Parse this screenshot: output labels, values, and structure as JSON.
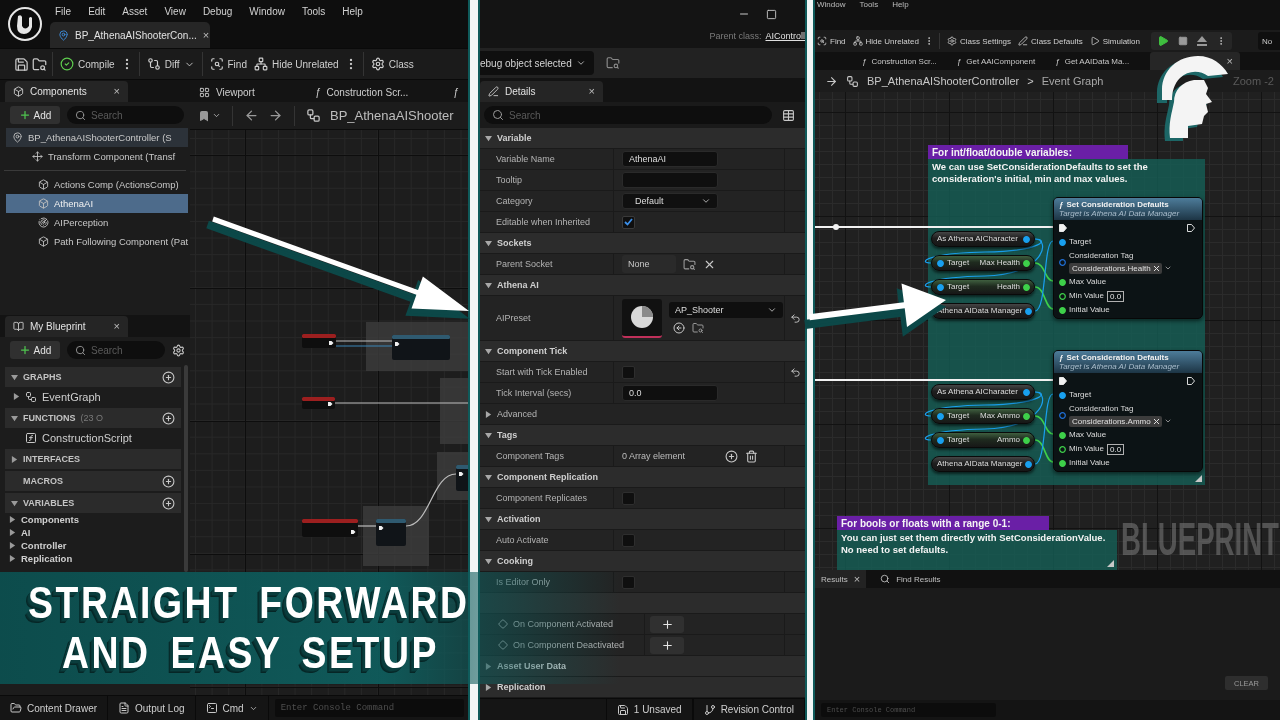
{
  "left_editor": {
    "menu": [
      "File",
      "Edit",
      "Asset",
      "View",
      "Debug",
      "Window",
      "Tools",
      "Help"
    ],
    "document_tab": {
      "title": "BP_AthenaAIShooterCon...",
      "close": "×"
    },
    "toolbar": [
      {
        "label": "Compile",
        "kind": "menu"
      },
      {
        "label": "Diff",
        "kind": "dropdown"
      },
      {
        "label": "Find",
        "kind": "plain"
      },
      {
        "label": "Hide Unrelated",
        "kind": "menu"
      },
      {
        "label": "Class",
        "kind": "plain"
      }
    ],
    "components_panel": {
      "tab": "Components",
      "close": "×",
      "add": "Add",
      "search_placeholder": "Search",
      "tree": [
        {
          "label": "BP_AthenaAIShooterController (S",
          "kind": "actor",
          "selected": false,
          "children": [
            {
              "label": "Transform Component (Transf",
              "kind": "transform",
              "selected": false
            },
            {
              "label": "Actions Comp (ActionsComp)",
              "kind": "component",
              "selected": false
            },
            {
              "label": "AthenaAI",
              "kind": "component",
              "selected": true
            },
            {
              "label": "AIPerception",
              "kind": "perception",
              "selected": false
            },
            {
              "label": "Path Following Component (Pat",
              "kind": "component",
              "selected": false
            }
          ]
        }
      ]
    },
    "graph_tabs": [
      {
        "kind": "viewport",
        "label": "Viewport"
      },
      {
        "kind": "function",
        "icon": "ƒ",
        "label": "Construction Scr..."
      },
      {
        "kind": "function",
        "icon": "ƒ"
      }
    ],
    "graph_breadcrumb": "BP_AthenaAIShooter",
    "blueprint_panel": {
      "tab": "My Blueprint",
      "close": "×",
      "add": "Add",
      "search_placeholder": "Search",
      "sections": [
        {
          "title": "GRAPHS",
          "expanded": true,
          "addable": true,
          "items": [
            {
              "label": "EventGraph",
              "kind": "graph",
              "expanded": false
            }
          ]
        },
        {
          "title": "FUNCTIONS",
          "count": "(23 O",
          "expanded": true,
          "addable": true,
          "items": [
            {
              "label": "ConstructionScript",
              "kind": "function"
            }
          ]
        },
        {
          "title": "INTERFACES",
          "expanded": false,
          "addable": false
        },
        {
          "title": "MACROS",
          "addable": true
        },
        {
          "title": "VARIABLES",
          "expanded": true,
          "addable": true,
          "items": [
            {
              "label": "Components",
              "kind": "category",
              "expanded": false
            },
            {
              "label": "AI",
              "kind": "category",
              "expanded": false
            },
            {
              "label": "Controller",
              "kind": "category",
              "expanded": false
            },
            {
              "label": "Replication",
              "kind": "category",
              "expanded": false
            }
          ]
        }
      ]
    },
    "status_bar": {
      "buttons": [
        {
          "label": "Content Drawer"
        },
        {
          "label": "Output Log"
        }
      ],
      "command": "Cmd",
      "console_placeholder": "Enter Console Command"
    }
  },
  "details_editor": {
    "parent_class": {
      "label": "Parent class:",
      "value": "AIControll"
    },
    "debug_filter": "ebug object selected",
    "tab": {
      "title": "Details",
      "close": "×"
    },
    "search_placeholder": "Search",
    "rows": [
      {
        "kind": "section",
        "title": "Variable",
        "expanded": true
      },
      {
        "kind": "text",
        "label": "Variable Name",
        "value": "AthenaAI",
        "modified": false
      },
      {
        "kind": "text",
        "label": "Tooltip",
        "modified": false
      },
      {
        "kind": "dropdown",
        "label": "Category",
        "value": "Default",
        "modified": false
      },
      {
        "kind": "checkbox",
        "label": "Editable when Inherited",
        "checked": true,
        "modified": false
      },
      {
        "kind": "section",
        "title": "Sockets",
        "expanded": true
      },
      {
        "kind": "socket",
        "label": "Parent Socket",
        "value": "None",
        "modified": false
      },
      {
        "kind": "section",
        "title": "Athena AI",
        "expanded": true
      },
      {
        "kind": "asset",
        "label": "AIPreset",
        "value": "AP_Shooter",
        "modified": true
      },
      {
        "kind": "section",
        "title": "Component Tick",
        "expanded": true
      },
      {
        "kind": "checkbox",
        "label": "Start with Tick Enabled",
        "checked": false,
        "modified": true
      },
      {
        "kind": "text",
        "label": "Tick Interval (secs)",
        "value": "0.0",
        "modified": false
      },
      {
        "kind": "subsection",
        "title": "Advanced",
        "expanded": false
      },
      {
        "kind": "section",
        "title": "Tags",
        "expanded": true
      },
      {
        "kind": "array",
        "label": "Component Tags",
        "value": "0 Array element",
        "modified": false
      },
      {
        "kind": "section",
        "title": "Component Replication",
        "expanded": true
      },
      {
        "kind": "checkbox",
        "label": "Component Replicates",
        "checked": false,
        "modified": false
      },
      {
        "kind": "section",
        "title": "Activation",
        "expanded": true
      },
      {
        "kind": "checkbox",
        "label": "Auto Activate",
        "checked": false,
        "modified": false
      },
      {
        "kind": "section",
        "title": "Cooking",
        "expanded": true
      },
      {
        "kind": "checkbox",
        "label": "Is Editor Only",
        "checked": false,
        "modified": false
      },
      {
        "kind": "section"
      },
      {
        "kind": "event",
        "label": "On Component Activated",
        "modified": false
      },
      {
        "kind": "event",
        "label": "On Component Deactivated",
        "modified": false
      },
      {
        "kind": "section",
        "title": "Asset User Data",
        "expanded": false
      },
      {
        "kind": "section",
        "title": "Replication",
        "expanded": false
      }
    ],
    "status_bar": [
      {
        "label": "1 Unsaved"
      },
      {
        "label": "Revision Control"
      }
    ]
  },
  "graph_editor": {
    "menu": [
      "Window",
      "Tools",
      "Help"
    ],
    "toolbar": [
      {
        "label": "Find",
        "kind": "plain"
      },
      {
        "label": "Hide Unrelated",
        "kind": "menu"
      },
      {
        "label": "Class Settings",
        "kind": "plain"
      },
      {
        "label": "Class Defaults",
        "kind": "plain"
      },
      {
        "label": "Simulation",
        "kind": "plain"
      }
    ],
    "debug_filter": "No",
    "tabs": [
      {
        "kind": "function",
        "icon": "ƒ",
        "label": "Construction Scr...",
        "selected": false
      },
      {
        "kind": "function",
        "icon": "ƒ",
        "label": "Get AAIComponent",
        "selected": false
      },
      {
        "kind": "function",
        "icon": "ƒ",
        "label": "Get AAIData Ma...",
        "selected": false
      },
      {
        "kind": "graph",
        "close": "×",
        "selected": true
      }
    ],
    "breadcrumb": {
      "blueprint": "BP_AthenaAIShooterController",
      "separator": ">",
      "graph": "Event Graph"
    },
    "zoom": "Zoom -2",
    "graph_type": "BLUEPRINT",
    "comments": [
      {
        "title": "For int/float/double variables:",
        "lines": [
          "We can use SetConsiderationDefaults to set the",
          "consideration's initial, min and max values."
        ]
      },
      {
        "title": "For bools or floats with a range 0-1:",
        "lines": [
          "You can just set them directly with SetConsiderationValue.",
          "No need to set defaults."
        ]
      }
    ],
    "node_groups": [
      {
        "function": {
          "icon": "ƒ",
          "title": "Set Consideration Defaults",
          "subtitle": "Target is Athena AI Data Manager",
          "exec": {
            "input_connected": true,
            "output_connected": false
          },
          "pins": [
            {
              "label": "Target",
              "kind": "object",
              "connected": true
            },
            {
              "label": "Consideration Tag",
              "kind": "tag",
              "connected": false,
              "value": "Considerations.Health"
            },
            {
              "label": "Max Value",
              "kind": "float",
              "connected": true
            },
            {
              "label": "Min Value",
              "kind": "float",
              "connected": false,
              "value": "0.0"
            },
            {
              "label": "Initial Value",
              "kind": "float",
              "connected": true
            }
          ]
        },
        "cast": {
          "label": "As Athena AICharacter",
          "connected": true
        },
        "getters": [
          {
            "input": "Target",
            "output": "Max Health",
            "input_connected": true,
            "output_connected": true
          },
          {
            "input": "Target",
            "output": "Health",
            "input_connected": true,
            "output_connected": true
          }
        ],
        "manager": {
          "label": "Athena AIData Manager",
          "connected": true
        }
      },
      {
        "function": {
          "icon": "ƒ",
          "title": "Set Consideration Defaults",
          "subtitle": "Target is Athena AI Data Manager",
          "exec": {
            "input_connected": true,
            "output_connected": false
          },
          "pins": [
            {
              "label": "Target",
              "kind": "object",
              "connected": true
            },
            {
              "label": "Consideration Tag",
              "kind": "tag",
              "connected": false,
              "value": "Considerations.Ammo"
            },
            {
              "label": "Max Value",
              "kind": "float",
              "connected": true
            },
            {
              "label": "Min Value",
              "kind": "float",
              "connected": false,
              "value": "0.0"
            },
            {
              "label": "Initial Value",
              "kind": "float",
              "connected": true
            }
          ]
        },
        "cast": {
          "label": "As Athena AICharacter",
          "connected": true
        },
        "getters": [
          {
            "input": "Target",
            "output": "Max Ammo",
            "input_connected": true,
            "output_connected": true
          },
          {
            "input": "Target",
            "output": "Ammo",
            "input_connected": true,
            "output_connected": true
          }
        ],
        "manager": {
          "label": "Athena AIData Manager",
          "connected": true
        }
      }
    ],
    "results_tabs": [
      {
        "kind": "compiler",
        "label": "Results",
        "close": "×",
        "selected": true
      },
      {
        "kind": "find",
        "label": "Find Results",
        "selected": false
      }
    ],
    "clear_button": "CLEAR",
    "console_placeholder": "Enter Console Command"
  },
  "banner": {
    "lines": [
      "STRAIGHT FORWARD",
      "AND EASY SETUP"
    ]
  }
}
